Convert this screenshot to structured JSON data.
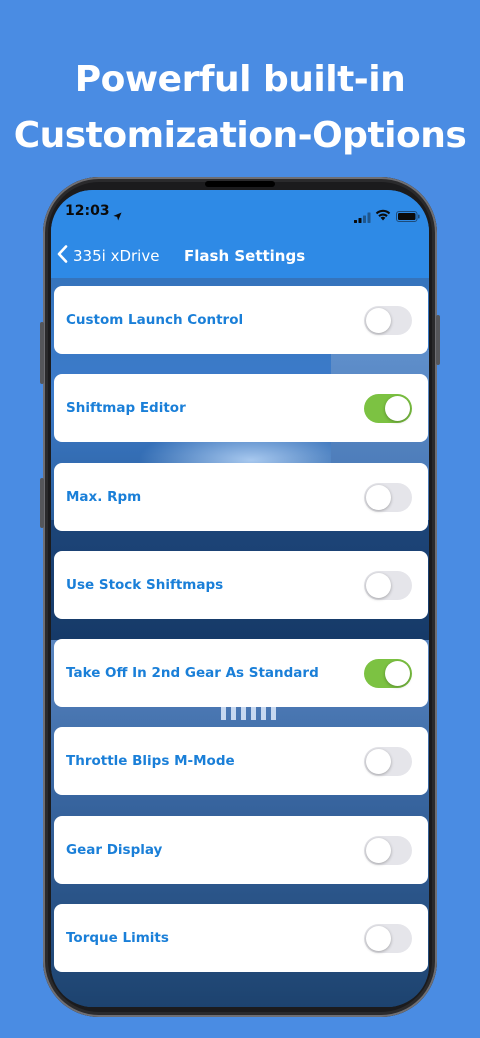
{
  "promo": {
    "line1": "Powerful built-in",
    "line2": "Customization-Options"
  },
  "status_bar": {
    "time": "12:03",
    "icons": [
      "location-arrow-icon",
      "cellular-signal-icon",
      "wifi-icon",
      "battery-icon"
    ]
  },
  "nav": {
    "back_label": "335i xDrive",
    "title": "Flash Settings"
  },
  "settings": [
    {
      "label": "Custom Launch Control",
      "enabled": false
    },
    {
      "label": "Shiftmap Editor",
      "enabled": true
    },
    {
      "label": "Max. Rpm",
      "enabled": false
    },
    {
      "label": "Use Stock Shiftmaps",
      "enabled": false
    },
    {
      "label": "Take Off In 2nd Gear As Standard",
      "enabled": true
    },
    {
      "label": "Throttle Blips M-Mode",
      "enabled": false
    },
    {
      "label": "Gear Display",
      "enabled": false
    },
    {
      "label": "Torque Limits",
      "enabled": false
    }
  ],
  "colors": {
    "page_background": "#4a8ce3",
    "nav_background": "#2e8ae6",
    "label_text": "#1a7fd8",
    "toggle_on": "#7cc242",
    "toggle_off": "#e5e5ea"
  }
}
